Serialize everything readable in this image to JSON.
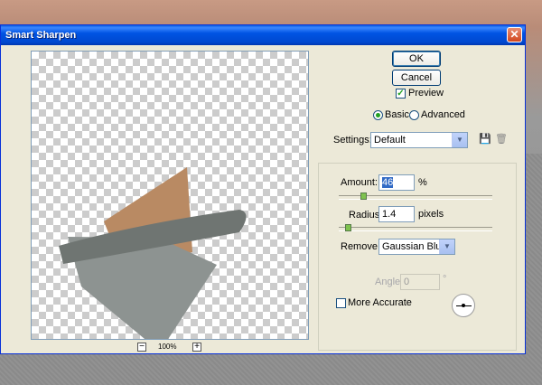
{
  "window": {
    "title": "Smart Sharpen"
  },
  "preview": {
    "zoom": "100%",
    "zoom_out": "−",
    "zoom_in": "+"
  },
  "buttons": {
    "ok": "OK",
    "cancel": "Cancel"
  },
  "preview_checkbox": {
    "label": "Preview",
    "checked": true
  },
  "mode": {
    "options": [
      "Basic",
      "Advanced"
    ],
    "selected": "Basic"
  },
  "settings": {
    "label": "Settings:",
    "value": "Default"
  },
  "amount": {
    "label": "Amount:",
    "value": "46",
    "unit": "%",
    "percent": 46,
    "max": 500
  },
  "radius": {
    "label": "Radius:",
    "value": "1.4",
    "unit": "pixels",
    "max": 64
  },
  "remove": {
    "label": "Remove:",
    "value": "Gaussian Blur"
  },
  "angle": {
    "label": "Angle:",
    "value": "0",
    "unit": "°"
  },
  "more_accurate": {
    "label": "More Accurate",
    "checked": false
  },
  "colors": {
    "title_bar": "#0054e3",
    "dialog_bg": "#ece9d8",
    "close": "#d1461d"
  }
}
